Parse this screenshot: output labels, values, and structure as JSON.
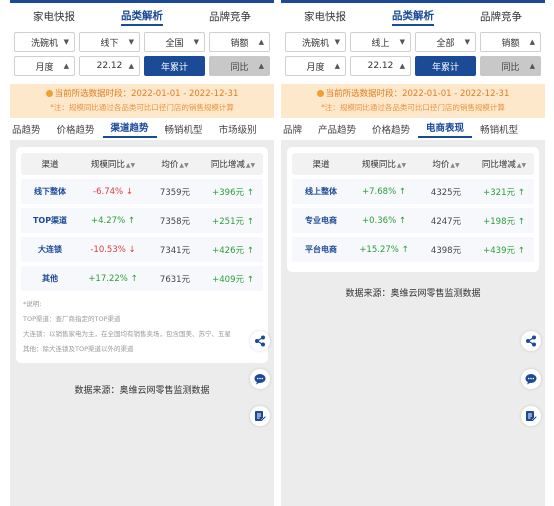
{
  "colors": {
    "brand": "#1b4a97",
    "positive": "#2a9d3a",
    "negative": "#e03b3b",
    "notice_bg": "#fde8cc",
    "notice_text": "#e27d1f"
  },
  "left": {
    "nav": [
      "家电快报",
      "品类解析",
      "品牌竞争"
    ],
    "filters_row1": [
      "洗碗机",
      "线下",
      "全国",
      "销额"
    ],
    "filters_row2": {
      "period": "月度",
      "month": "22.12",
      "cumulative": "年累计",
      "compare": "同比"
    },
    "notice": {
      "line1": "当前所选数据时段：2022-01-01 - 2022-12-31",
      "line2": "*注：规模同比通过各品类可比口径门店的销售规模计算"
    },
    "subtabs": [
      "品趋势",
      "价格趋势",
      "渠道趋势",
      "畅销机型",
      "市场级别"
    ],
    "table": {
      "headers": [
        "渠道",
        "规模同比",
        "均价",
        "同比增减"
      ],
      "rows": [
        {
          "name": "线下整体",
          "yoy": "-6.74%",
          "price": "7359元",
          "delta": "+396元"
        },
        {
          "name": "TOP渠道",
          "yoy": "+4.27%",
          "price": "7358元",
          "delta": "+251元"
        },
        {
          "name": "大连锁",
          "yoy": "-10.53%",
          "price": "7341元",
          "delta": "+426元"
        },
        {
          "name": "其他",
          "yoy": "+17.22%",
          "price": "7631元",
          "delta": "+409元"
        }
      ]
    },
    "notes": [
      "*说明:",
      "TOP渠道：查厂商指定的TOP渠道",
      "大连锁：以销售家电为主，在全国均有销售卖场，包含国美、苏宁、五星",
      "其他：除大连锁及TOP渠道以外的渠道"
    ],
    "source": "数据来源：奥维云网零售监测数据"
  },
  "right": {
    "nav": [
      "家电快报",
      "品类解析",
      "品牌竞争"
    ],
    "filters_row1": [
      "洗碗机",
      "线上",
      "全部",
      "销额"
    ],
    "filters_row2": {
      "period": "月度",
      "month": "22.12",
      "cumulative": "年累计",
      "compare": "同比"
    },
    "notice": {
      "line1": "当前所选数据时段：2022-01-01 - 2022-12-31",
      "line2": "*注：规模同比通过各品类可比口径门店的销售规模计算"
    },
    "subtabs": [
      "品牌",
      "产品趋势",
      "价格趋势",
      "电商表现",
      "畅销机型"
    ],
    "table": {
      "headers": [
        "渠道",
        "规模同比",
        "均价",
        "同比增减"
      ],
      "rows": [
        {
          "name": "线上整体",
          "yoy": "+7.68%",
          "price": "4325元",
          "delta": "+321元"
        },
        {
          "name": "专业电商",
          "yoy": "+0.36%",
          "price": "4247元",
          "delta": "+198元"
        },
        {
          "name": "平台电商",
          "yoy": "+15.27%",
          "price": "4398元",
          "delta": "+439元"
        }
      ]
    },
    "source": "数据来源：奥维云网零售监测数据"
  },
  "icons": [
    "share-icon",
    "chat-icon",
    "edit-icon"
  ]
}
